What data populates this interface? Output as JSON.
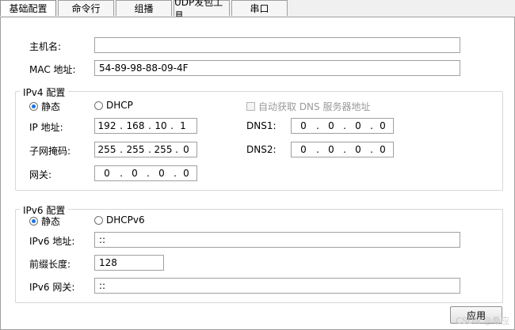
{
  "tabs": [
    {
      "label": "基础配置",
      "active": true
    },
    {
      "label": "命令行",
      "active": false
    },
    {
      "label": "组播",
      "active": false
    },
    {
      "label": "UDP发包工具",
      "active": false
    },
    {
      "label": "串口",
      "active": false
    }
  ],
  "basic": {
    "hostname_label": "主机名:",
    "hostname_value": "",
    "mac_label": "MAC 地址:",
    "mac_value": "54-89-98-88-09-4F"
  },
  "ipv4": {
    "legend": "IPv4 配置",
    "static_label": "静态",
    "dhcp_label": "DHCP",
    "mode": "static",
    "auto_dns_label": "自动获取 DNS 服务器地址",
    "ip_label": "IP 地址:",
    "ip": [
      "192",
      "168",
      "10",
      "1"
    ],
    "mask_label": "子网掩码:",
    "mask": [
      "255",
      "255",
      "255",
      "0"
    ],
    "gateway_label": "网关:",
    "gateway": [
      "0",
      "0",
      "0",
      "0"
    ],
    "dns1_label": "DNS1:",
    "dns1": [
      "0",
      "0",
      "0",
      "0"
    ],
    "dns2_label": "DNS2:",
    "dns2": [
      "0",
      "0",
      "0",
      "0"
    ]
  },
  "ipv6": {
    "legend": "IPv6 配置",
    "static_label": "静态",
    "dhcp_label": "DHCPv6",
    "mode": "static",
    "addr_label": "IPv6 地址:",
    "addr_value": "::",
    "prefix_label": "前缀长度:",
    "prefix_value": "128",
    "gateway_label": "IPv6 网关:",
    "gateway_value": "::"
  },
  "apply_label": "应用",
  "watermark": "CSDN @桑应",
  "colors": {
    "radio_selected": "#1a73e8",
    "border": "#a0a0a0"
  }
}
